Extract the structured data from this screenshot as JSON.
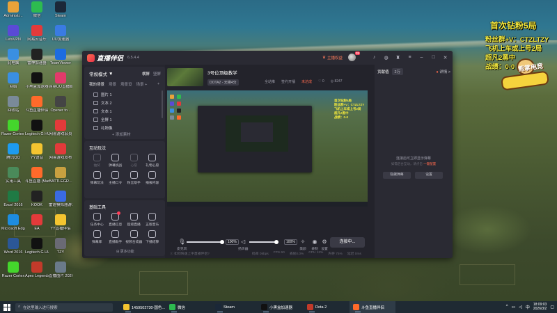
{
  "desktop_icons": [
    {
      "label": "Administr...",
      "color": "#e8a33a"
    },
    {
      "label": "微信",
      "color": "#2dbb4f"
    },
    {
      "label": "Steam",
      "color": "#1b2838"
    },
    {
      "label": "LetsVPN",
      "color": "#5a4ad6"
    },
    {
      "label": "网易云音乐",
      "color": "#e23a3a"
    },
    {
      "label": "UU加速器",
      "color": "#3a7be2"
    },
    {
      "label": "此电脑",
      "color": "#3a8fe2"
    },
    {
      "label": "雷神加速器",
      "color": "#222222"
    },
    {
      "label": "TeamViewer",
      "color": "#1d6ce0"
    },
    {
      "label": "网络",
      "color": "#3a8fe2"
    },
    {
      "label": "小黑盒加速器",
      "color": "#111111"
    },
    {
      "label": "网易UU直播姬",
      "color": "#e23a6a"
    },
    {
      "label": "回收站",
      "color": "#7a8a99"
    },
    {
      "label": "斗鱼直播伴侣",
      "color": "#ff6a2a"
    },
    {
      "label": "Opener to...",
      "color": "#444444"
    },
    {
      "label": "Razer Cortex Launch...",
      "color": "#44d62c"
    },
    {
      "label": "Logitech G HUB",
      "color": "#111111"
    },
    {
      "label": "网易游戏会员",
      "color": "#e23a3a"
    },
    {
      "label": "腾讯QQ",
      "color": "#1d9bf0"
    },
    {
      "label": "YY语音",
      "color": "#f4c430"
    },
    {
      "label": "网易游戏发布",
      "color": "#e23a3a"
    },
    {
      "label": "实用工具",
      "color": "#4a8a5a"
    },
    {
      "label": "斗鱼直播 (Maspcm)",
      "color": "#ff6a2a"
    },
    {
      "label": "BATTLEGR...",
      "color": "#c8a040"
    },
    {
      "label": "Excel 2016",
      "color": "#1f7a44"
    },
    {
      "label": "KOOK",
      "color": "#222222"
    },
    {
      "label": "雷霆模拟器游戏",
      "color": "#3a6ae2"
    },
    {
      "label": "Microsoft Edge",
      "color": "#1d8ce0"
    },
    {
      "label": "EA",
      "color": "#e23a3a"
    },
    {
      "label": "YY直播伴侣",
      "color": "#f4c430"
    },
    {
      "label": "Word 2016",
      "color": "#2b5797"
    },
    {
      "label": "Logitech G HUB",
      "color": "#111111"
    },
    {
      "label": "TZY",
      "color": "#6a6a75"
    },
    {
      "label": "Razer Cortex",
      "color": "#44d62c"
    },
    {
      "label": "Apex Legends",
      "color": "#c23a2a"
    },
    {
      "label": "直播图片 20260131...",
      "color": "#6a7a8a"
    }
  ],
  "overlay": {
    "title": "首次钻粉5局",
    "line1": "粉丝群+V：CTZLTZY",
    "line2": "飞机上车或上号2局",
    "line3": "超凡2黑中",
    "line4": "战绩：0-0",
    "brand": "熊掌电竞"
  },
  "app": {
    "name": "直播伴侣",
    "version": "6.5.4.4",
    "titlebar": {
      "open_broadcast": "主播权益",
      "level": "35",
      "icons": [
        "bell-icon",
        "headset-icon",
        "shirt-icon",
        "menu-icon",
        "minimize-icon",
        "maximize-icon",
        "close-icon"
      ]
    },
    "left": {
      "mode_label": "常规模式",
      "scene_options": [
        "横屏",
        "竖屏"
      ],
      "scene_row": [
        "我的场景",
        "场景",
        "场景设",
        "场景 +"
      ],
      "sources": [
        "图片 1",
        "文本 2",
        "文本 1",
        "全屏 1",
        "礼物像"
      ],
      "add_source": "+ 添加素材",
      "interact_title": "互动玩法",
      "interact_tools": [
        {
          "label": "抽奖",
          "dim": true
        },
        {
          "label": "弹幕挑战",
          "dim": false
        },
        {
          "label": "心愿",
          "dim": true
        },
        {
          "label": "礼物心愿",
          "dim": false
        },
        {
          "label": "弹幕玩法",
          "dim": false
        },
        {
          "label": "主播口令",
          "dim": false
        },
        {
          "label": "粉丝助手",
          "dim": false
        },
        {
          "label": "播报内容",
          "dim": false
        }
      ],
      "basic_title": "基础工具",
      "basic_tools": [
        {
          "label": "任务中心",
          "badge": false
        },
        {
          "label": "直播信息",
          "badge": true
        },
        {
          "label": "超级直播",
          "badge": false
        },
        {
          "label": "正版音乐",
          "badge": false
        },
        {
          "label": "弹幕库",
          "badge": false
        },
        {
          "label": "直播助手",
          "badge": false
        },
        {
          "label": "视频合成器",
          "badge": false
        },
        {
          "label": "下播结算",
          "badge": false
        }
      ],
      "more_features": "更多功能"
    },
    "center": {
      "live_title": "3号位顶级教学",
      "tag": "DOTA2 - 天梯4分",
      "actions": [
        "全站推",
        "签约开播",
        "未达成"
      ],
      "likes": "0",
      "viewers": "8247",
      "controls": {
        "mic_label": "麦克风",
        "mic_percent": "100%",
        "speaker_label": "扬声器",
        "speaker_percent": "100%",
        "beauty_label": "美颜",
        "record_label": "录制",
        "settings_label": "设置",
        "start_live_label": "连接中..."
      }
    },
    "right": {
      "tabs": [
        "贡献值",
        "2万"
      ],
      "tab_extra": "开播通知",
      "detail_label": "详情 >",
      "share_label": "分享",
      "empty_line1": "连接后可立即显示弹幕",
      "empty_line2": "如需后台互动，请点击",
      "empty_link": "一键配置",
      "buttons": [
        "隐藏弹幕",
        "设置"
      ]
    },
    "status": {
      "left": "如何快速上手直播伴侣?",
      "stats": [
        "码率 0kbps",
        "FPS 60",
        "丢帧0.0%",
        "CPU 12%",
        "内存 75%",
        "延迟 0ms"
      ]
    }
  },
  "taskbar": {
    "search_placeholder": "在这里输入进行搜索",
    "apps": [
      {
        "label": "1459502730-国色...",
        "color": "#f4c430",
        "running": true,
        "active": false
      },
      {
        "label": "微信",
        "color": "#2dbb4f",
        "running": true,
        "active": false
      },
      {
        "label": "Steam",
        "color": "#1b2838",
        "running": true,
        "active": false
      },
      {
        "label": "小黑盒加速器",
        "color": "#111111",
        "running": true,
        "active": false
      },
      {
        "label": "Dota 2",
        "color": "#c23a2a",
        "running": true,
        "active": false
      },
      {
        "label": "斗鱼直播伴侣",
        "color": "#ff6a2a",
        "running": true,
        "active": true
      }
    ],
    "time": "18:09:03",
    "date": "2026/3/2"
  }
}
